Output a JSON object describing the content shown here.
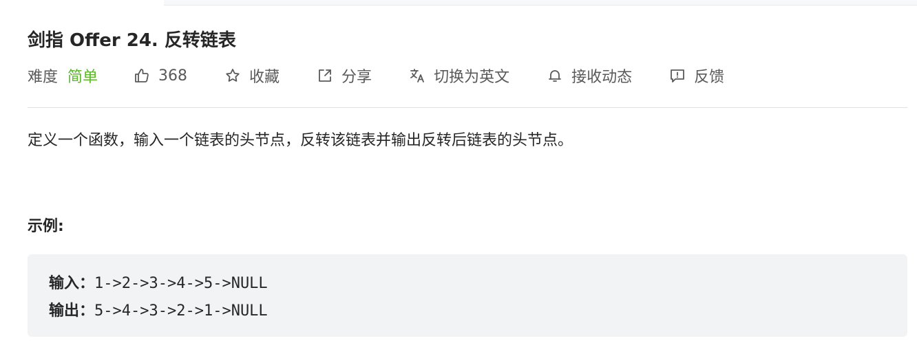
{
  "problem": {
    "title": "剑指 Offer 24. 反转链表",
    "difficulty_label": "难度",
    "difficulty_value": "简单",
    "difficulty_color": "#5ab726",
    "likes": "368",
    "actions": {
      "favorite": "收藏",
      "share": "分享",
      "translate": "切换为英文",
      "notify": "接收动态",
      "feedback": "反馈"
    },
    "icons": {
      "likes": "thumbs-up-icon",
      "favorite": "star-icon",
      "share": "share-icon",
      "translate": "translate-icon",
      "notify": "bell-icon",
      "feedback": "feedback-icon"
    },
    "description": "定义一个函数，输入一个链表的头节点，反转该链表并输出反转后链表的头节点。",
    "example_heading": "示例:",
    "example": {
      "input_label": "输入：",
      "input_value": "1->2->3->4->5->NULL",
      "output_label": "输出：",
      "output_value": "5->4->3->2->1->NULL"
    }
  }
}
